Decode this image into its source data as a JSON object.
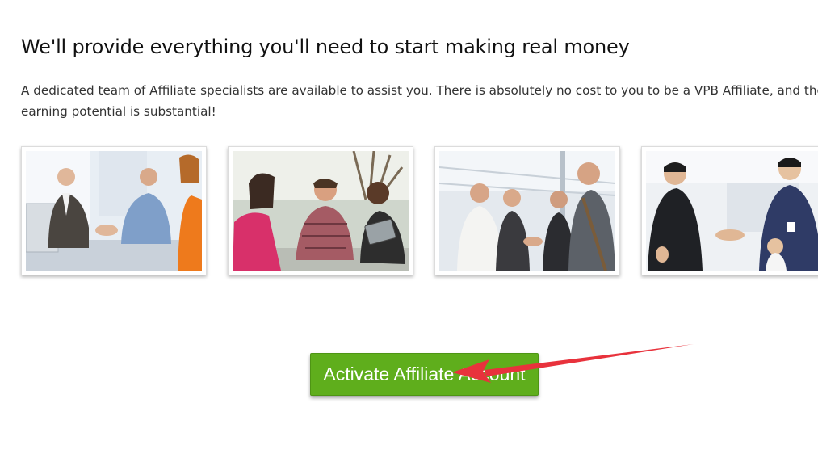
{
  "section": {
    "heading": "We'll provide everything you'll need to start making real money",
    "intro": "A dedicated team of Affiliate specialists are available to assist you. There is absolutely no cost to you to be a VPB Affiliate, and the earning potential is substantial!"
  },
  "photos": [
    {
      "subject": "business-handshake-office-photo"
    },
    {
      "subject": "team-meeting-tablet-photo"
    },
    {
      "subject": "business-group-handshake-photo"
    },
    {
      "subject": "office-handshake-applause-photo"
    }
  ],
  "cta": {
    "label": "Activate Affiliate Account",
    "color": "#5fae1c"
  },
  "annotation": {
    "type": "arrow",
    "color": "#e8323c",
    "points_to": "cta-button"
  }
}
